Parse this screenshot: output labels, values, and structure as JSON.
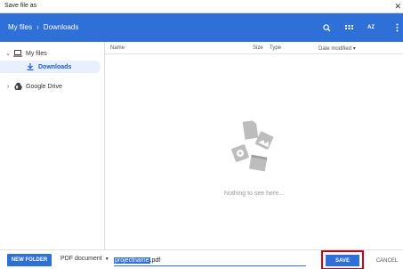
{
  "window": {
    "title": "Save file as",
    "close_icon": "close-icon"
  },
  "header": {
    "breadcrumb": [
      "My files",
      "Downloads"
    ],
    "separator": "›",
    "sort_label": "AZ",
    "accent": "#2f6fd8"
  },
  "sidebar": {
    "items": [
      {
        "label": "My files",
        "icon": "laptop-icon",
        "expanded": true
      },
      {
        "label": "Downloads",
        "icon": "download-icon",
        "selected": true
      },
      {
        "label": "Google Drive",
        "icon": "drive-icon",
        "expanded": false
      }
    ]
  },
  "list": {
    "columns": [
      "Name",
      "Size",
      "Type",
      "Date modified"
    ],
    "sort_indicator": "▾",
    "empty_message": "Nothing to see here..."
  },
  "footer": {
    "new_folder_label": "NEW FOLDER",
    "file_type": "PDF document",
    "filename_selected": "projectname",
    "filename_ext": ".pdf",
    "save_label": "SAVE",
    "cancel_label": "CANCEL",
    "highlight_color": "#d0021b"
  }
}
